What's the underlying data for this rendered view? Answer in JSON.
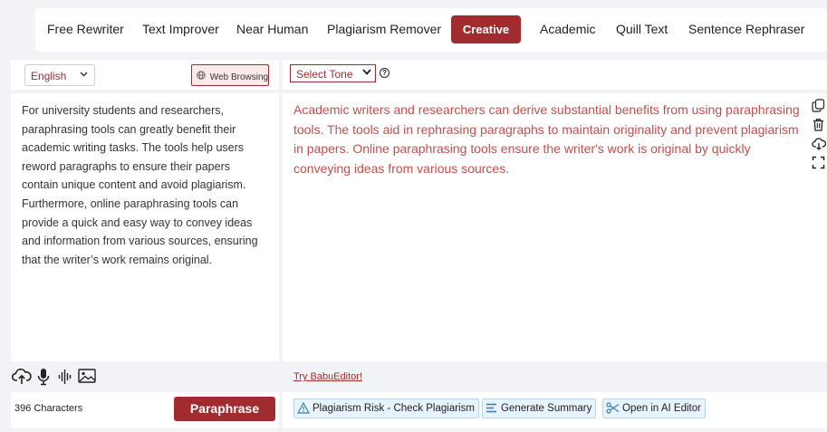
{
  "modes": [
    {
      "label": "Free Rewriter"
    },
    {
      "label": "Text Improver"
    },
    {
      "label": "Near Human"
    },
    {
      "label": "Plagiarism Remover"
    },
    {
      "label": "Creative",
      "active": true
    },
    {
      "label": "Academic"
    },
    {
      "label": "Quill Text"
    },
    {
      "label": "Sentence Rephraser"
    }
  ],
  "input": {
    "language": "English",
    "web_browsing_label": "Web Browsing",
    "text": "For university students and researchers, paraphrasing tools can greatly benefit their academic writing tasks. The tools help users reword paragraphs to ensure their papers contain unique content and avoid plagiarism. Furthermore, online paraphrasing tools can provide a quick and easy way to convey ideas and information from various sources, ensuring that the writer’s work remains original.",
    "char_count": "396 Characters",
    "paraphrase_label": "Paraphrase",
    "icons": [
      "upload-cloud-icon",
      "microphone-icon",
      "audio-wave-icon",
      "image-icon"
    ]
  },
  "output": {
    "tone_label": "Select Tone",
    "text": "Academic writers and researchers can derive substantial benefits from using paraphrasing tools. The tools aid in rephrasing paragraphs to maintain originality and prevent plagiarism in papers. Online paraphrasing tools ensure the writer's work is original by quickly conveying ideas from various sources.",
    "try_link": "Try BabuEditor!",
    "actions": {
      "plagiarism": "Plagiarism Risk - Check Plagiarism",
      "summary": "Generate Summary",
      "ai_editor": "Open in AI Editor"
    },
    "side_tools": [
      "copy-icon",
      "trash-icon",
      "download-icon",
      "fullscreen-icon"
    ]
  },
  "colors": {
    "accent": "#a12c30",
    "output_text": "#c0504d",
    "action_bg": "#e8f3fb",
    "page_bg": "#f1f3f6"
  }
}
